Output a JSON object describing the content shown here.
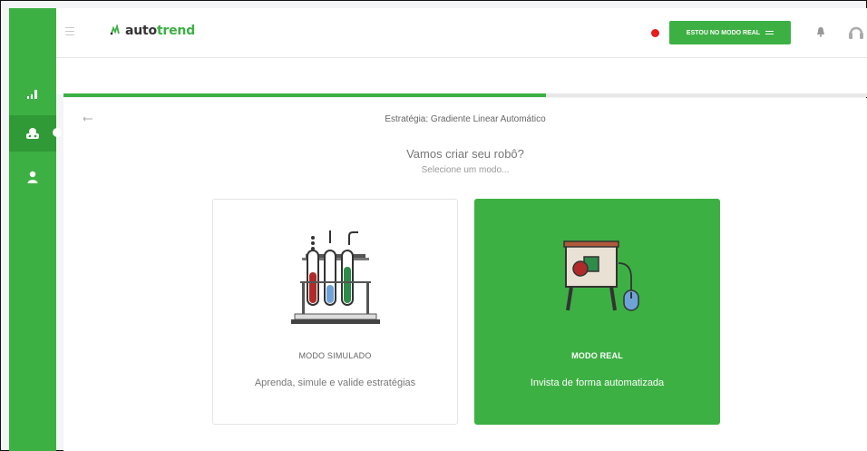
{
  "topbar": {
    "logo_prefix": "auto",
    "logo_suffix": "trend",
    "mode_button_label": "ESTOU NO MODO REAL"
  },
  "page": {
    "strategy_label": "Estratégia: Gradiente Linear Automático",
    "headline": "Vamos criar seu robô?",
    "subheadline": "Selecione um modo..."
  },
  "progress": {
    "fraction": 0.6
  },
  "cards": [
    {
      "title": "MODO SIMULADO",
      "description": "Aprenda, simule e valide estratégias"
    },
    {
      "title": "MODO REAL",
      "description": "Invista de forma automatizada"
    }
  ],
  "colors": {
    "brand": "#3db044",
    "status_dot": "#e21e1e"
  }
}
